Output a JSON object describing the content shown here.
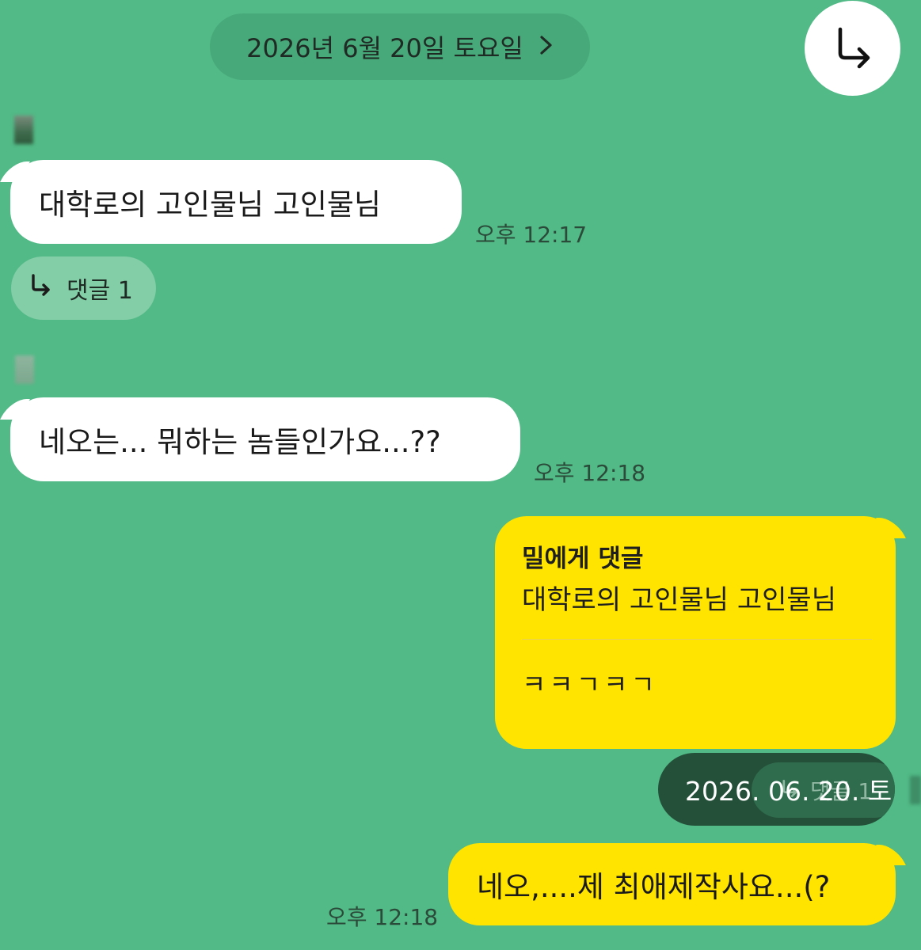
{
  "header": {
    "date": "2026년 6월 20일 토요일",
    "chevron_icon": "chevron-right-icon"
  },
  "shortcut": {
    "icon": "reply-arrow-icon"
  },
  "messages": [
    {
      "direction": "in",
      "text": "대학로의 고인물님 고인물님",
      "time": "오후 12:17",
      "replies": {
        "icon": "reply-arrow-icon",
        "label": "댓글 1"
      }
    },
    {
      "direction": "in",
      "text": "네오는... 뭐하는 놈들인가요...??",
      "time": "오후 12:18"
    },
    {
      "direction": "out",
      "quote_title": "밀에게 댓글",
      "quote_text": "대학로의 고인물님 고인물님",
      "text": "ㅋㅋㄱㅋㄱ"
    },
    {
      "direction": "out",
      "text": "네오,....제 최애제작사요...(?",
      "time": "오후 12:18"
    }
  ],
  "overlay": {
    "date": "2026. 06. 20. 토",
    "ghost_label": "댓글 1"
  },
  "colors": {
    "background": "#51ba86",
    "received_bubble": "#ffffff",
    "sent_bubble": "#ffe400",
    "tooltip": "#24503a"
  }
}
